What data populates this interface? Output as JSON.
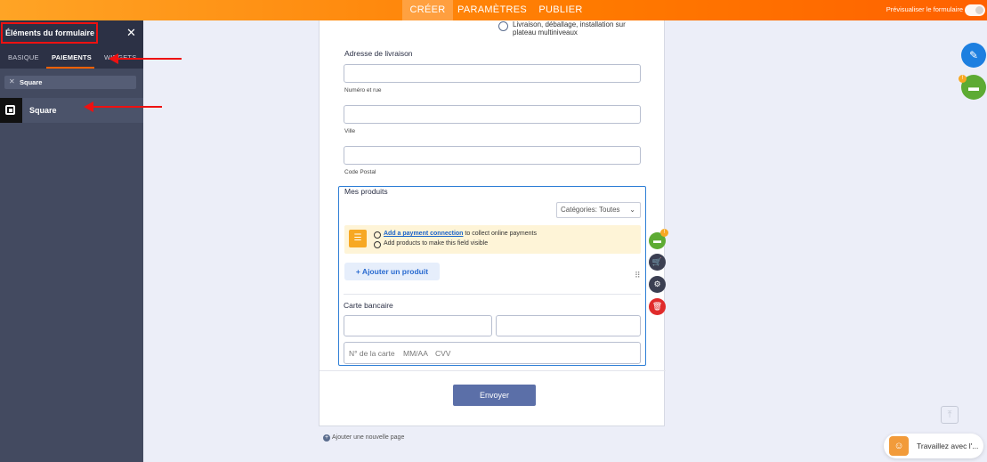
{
  "topbar": {
    "tabs": [
      "CRÉER",
      "PARAMÈTRES",
      "PUBLIER"
    ],
    "preview_label": "Prévisualiser le formulaire"
  },
  "panel": {
    "title": "Éléments du formulaire",
    "close": "✕",
    "tabs": [
      "BASIQUE",
      "PAIEMENTS",
      "WIDGETS"
    ],
    "search_value": "Square",
    "result": "Square"
  },
  "form": {
    "option_text_1": "Livraison, déballage, installation sur",
    "option_text_2": "plateau multiniveaux",
    "address": {
      "title": "Adresse de livraison",
      "street": "Numéro et rue",
      "city": "Ville",
      "postal": "Code Postal"
    },
    "products": {
      "title": "Mes produits",
      "category": "Catégories: Toutes",
      "warning_link": "Add a payment connection",
      "warning_rest": " to collect online payments",
      "warning_2": "Add products to make this field visible",
      "add_button": "+ Ajouter un produit"
    },
    "card": {
      "title": "Carte bancaire",
      "number": "N° de la carte",
      "expiry": "MM/AA",
      "cvv": "CVV"
    },
    "submit": "Envoyer"
  },
  "add_page": "Ajouter une nouvelle page",
  "tool_badge": "!",
  "chat_text": "Travaillez avec l'...",
  "icons": [
    "close-icon",
    "square-logo-icon",
    "checklist-icon",
    "payment-card-icon",
    "cart-icon",
    "gear-icon",
    "trash-icon",
    "drag-handle-icon",
    "paint-brush-icon",
    "arrow-up-icon"
  ],
  "colors": {
    "accent": "#ff7a00",
    "panel": "#434a60",
    "link": "#1a64c9",
    "selection": "#2f7fd6",
    "submit": "#5b6fa8"
  }
}
